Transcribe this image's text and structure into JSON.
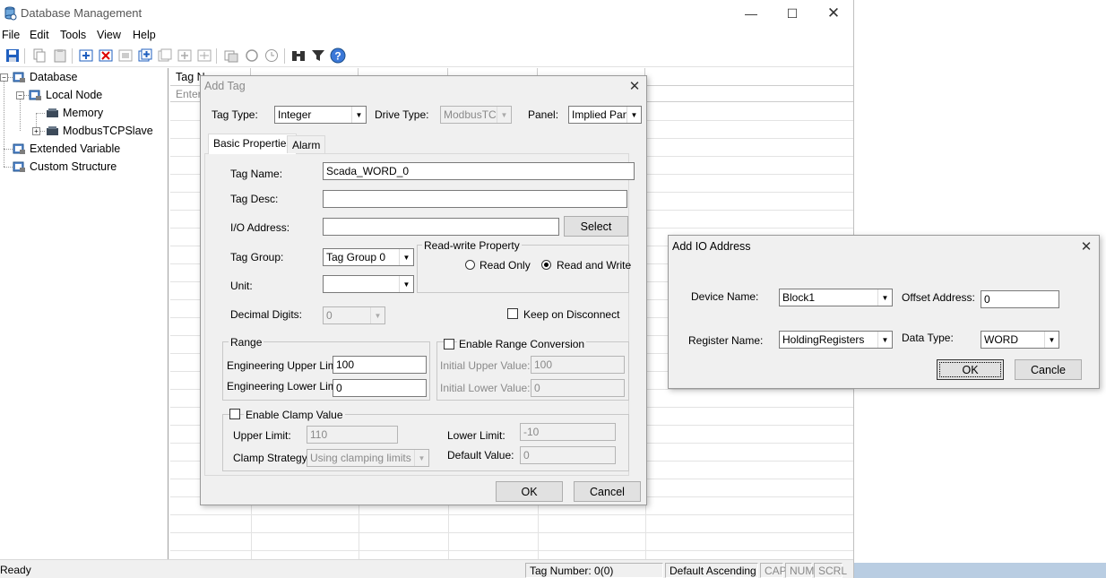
{
  "window": {
    "title": "Database Management"
  },
  "menu": [
    "File",
    "Edit",
    "Tools",
    "View",
    "Help"
  ],
  "tree": {
    "database": "Database",
    "local_node": "Local Node",
    "memory": "Memory",
    "modbus": "ModbusTCPSlave",
    "extended": "Extended Variable",
    "custom": "Custom Structure"
  },
  "grid": {
    "col1": "Tag N",
    "filter_row": "Enter"
  },
  "status": {
    "ready": "Ready",
    "tag_number": "Tag Number: 0(0)",
    "sort": "Default Ascending",
    "cap": "CAP",
    "num": "NUM",
    "scrl": "SCRL"
  },
  "add_tag": {
    "title": "Add Tag",
    "tag_type_label": "Tag Type:",
    "tag_type": "Integer",
    "drive_type_label": "Drive Type:",
    "drive_type": "ModbusTCP",
    "panel_label": "Panel:",
    "panel": "Implied Pane",
    "tab_basic": "Basic Properties",
    "tab_alarm": "Alarm",
    "tag_name_label": "Tag Name:",
    "tag_name": "Scada_WORD_0",
    "tag_desc_label": "Tag Desc:",
    "tag_desc": "",
    "io_address_label": "I/O Address:",
    "io_address": "",
    "select": "Select",
    "tag_group_label": "Tag Group:",
    "tag_group": "Tag Group 0",
    "rw_property": "Read-write Property",
    "read_only": "Read Only",
    "read_write": "Read and Write",
    "unit_label": "Unit:",
    "unit": "",
    "decimal_label": "Decimal Digits:",
    "decimal": "0",
    "keep_on_disconnect": "Keep on Disconnect",
    "range": "Range",
    "eng_upper_label": "Engineering Upper Limit:",
    "eng_upper": "100",
    "eng_lower_label": "Engineering Lower Limit:",
    "eng_lower": "0",
    "enable_range_conv": "Enable Range Conversion",
    "init_upper_label": "Initial Upper Value:",
    "init_upper": "100",
    "init_lower_label": "Initial Lower Value:",
    "init_lower": "0",
    "enable_clamp": "Enable Clamp Value",
    "upper_limit_label": "Upper Limit:",
    "upper_limit": "110",
    "lower_limit_label": "Lower Limit:",
    "lower_limit": "-10",
    "clamp_strategy_label": "Clamp Strategy:",
    "clamp_strategy": "Using clamping limits",
    "default_value_label": "Default Value:",
    "default_value": "0",
    "ok": "OK",
    "cancel": "Cancel"
  },
  "add_io": {
    "title": "Add IO Address",
    "device_name_label": "Device Name:",
    "device_name": "Block1",
    "offset_label": "Offset Address:",
    "offset": "0",
    "register_label": "Register Name:",
    "register": "HoldingRegisters",
    "data_type_label": "Data Type:",
    "data_type": "WORD",
    "ok": "OK",
    "cancel": "Cancle"
  }
}
